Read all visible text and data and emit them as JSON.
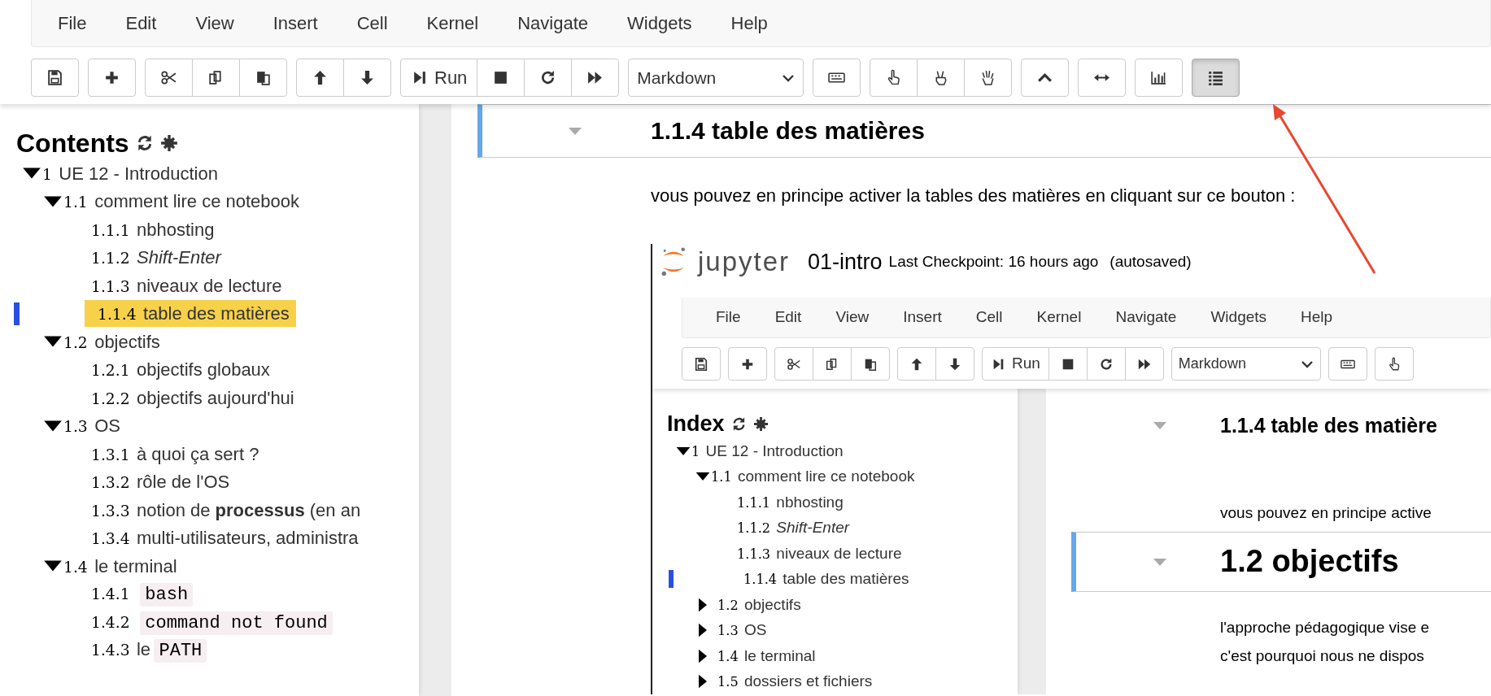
{
  "menu": [
    "File",
    "Edit",
    "View",
    "Insert",
    "Cell",
    "Kernel",
    "Navigate",
    "Widgets",
    "Help"
  ],
  "toolbar": [
    {
      "kind": "buttons",
      "buttons": [
        {
          "kind": "save",
          "pressed": false
        }
      ]
    },
    {
      "kind": "buttons",
      "buttons": [
        {
          "kind": "add",
          "pressed": false
        }
      ]
    },
    {
      "kind": "buttons",
      "buttons": [
        {
          "kind": "cut",
          "pressed": false
        },
        {
          "kind": "copy",
          "pressed": false
        },
        {
          "kind": "paste",
          "pressed": false
        }
      ]
    },
    {
      "kind": "buttons",
      "buttons": [
        {
          "kind": "move-up",
          "pressed": false
        },
        {
          "kind": "move-down",
          "pressed": false
        }
      ]
    },
    {
      "kind": "buttons",
      "buttons": [
        {
          "kind": "run",
          "label": "Run",
          "pressed": false
        },
        {
          "kind": "stop",
          "pressed": false
        },
        {
          "kind": "restart",
          "pressed": false
        },
        {
          "kind": "fast-forward",
          "pressed": false
        }
      ]
    },
    {
      "kind": "select",
      "value": "Markdown"
    },
    {
      "kind": "buttons",
      "buttons": [
        {
          "kind": "keyboard",
          "pressed": false
        }
      ]
    },
    {
      "kind": "buttons",
      "buttons": [
        {
          "kind": "pointing-hand",
          "pressed": false
        },
        {
          "kind": "peace-hand",
          "pressed": false
        },
        {
          "kind": "open-hand",
          "pressed": false
        }
      ]
    },
    {
      "kind": "buttons",
      "buttons": [
        {
          "kind": "chevron-up",
          "pressed": false
        }
      ]
    },
    {
      "kind": "buttons",
      "buttons": [
        {
          "kind": "arrows",
          "pressed": false
        }
      ]
    },
    {
      "kind": "buttons",
      "buttons": [
        {
          "kind": "bar-chart",
          "pressed": false
        }
      ]
    },
    {
      "kind": "buttons",
      "buttons": [
        {
          "kind": "list",
          "pressed": true
        }
      ]
    }
  ],
  "sidebar": {
    "title": "Contents",
    "highlight_selected": true,
    "items": [
      {
        "number": "1",
        "text": "UE 12 - Introduction",
        "expanded": true,
        "selected": false,
        "children": [
          {
            "number": "1.1",
            "text": "comment lire ce notebook",
            "expanded": true,
            "selected": false,
            "children": [
              {
                "number": "1.1.1",
                "text": "nbhosting",
                "selected": false
              },
              {
                "number": "1.1.2",
                "text": "Shift-Enter",
                "italic": true,
                "selected": false
              },
              {
                "number": "1.1.3",
                "text": "niveaux de lecture",
                "selected": false
              },
              {
                "number": "1.1.4",
                "text": "table des matières",
                "selected": true
              }
            ]
          },
          {
            "number": "1.2",
            "text": "objectifs",
            "expanded": true,
            "selected": false,
            "children": [
              {
                "number": "1.2.1",
                "text": "objectifs globaux",
                "selected": false
              },
              {
                "number": "1.2.2",
                "text": "objectifs aujourd'hui",
                "selected": false
              }
            ]
          },
          {
            "number": "1.3",
            "text": "OS",
            "expanded": true,
            "selected": false,
            "children": [
              {
                "number": "1.3.1",
                "text": "à quoi ça sert ?",
                "selected": false
              },
              {
                "number": "1.3.2",
                "text": "rôle de l'OS",
                "selected": false
              },
              {
                "number": "1.3.3",
                "text": "notion de **processus** (en an",
                "selected": false
              },
              {
                "number": "1.3.4",
                "text": "multi-utilisateurs, administra",
                "selected": false
              }
            ]
          },
          {
            "number": "1.4",
            "text": "le terminal",
            "expanded": true,
            "selected": false,
            "children": [
              {
                "number": "1.4.1",
                "code": "bash",
                "selected": false
              },
              {
                "number": "1.4.2",
                "code": "command not found",
                "selected": false
              },
              {
                "number": "1.4.3",
                "text": "le",
                "code": "PATH",
                "selected": false
              }
            ]
          }
        ]
      }
    ]
  },
  "notebook": {
    "cells": [
      {
        "kind": "h3",
        "text": "1.1.4  table des matières",
        "selected": true
      },
      {
        "kind": "text",
        "text": "vous pouvez en principe activer la tables des matières en cliquant sur ce bouton :"
      },
      {
        "kind": "screenshot",
        "logo_text": "jupyter",
        "notebook_name": "01-intro",
        "checkpoint": "Last Checkpoint: 16 hours ago",
        "autosave": "(autosaved)",
        "menu": [
          "File",
          "Edit",
          "View",
          "Insert",
          "Cell",
          "Kernel",
          "Navigate",
          "Widgets",
          "Help"
        ],
        "toolbar": [
          {
            "kind": "buttons",
            "buttons": [
              {
                "kind": "save",
                "pressed": false
              }
            ]
          },
          {
            "kind": "buttons",
            "buttons": [
              {
                "kind": "add",
                "pressed": false
              }
            ]
          },
          {
            "kind": "buttons",
            "buttons": [
              {
                "kind": "cut",
                "pressed": false
              },
              {
                "kind": "copy",
                "pressed": false
              },
              {
                "kind": "paste",
                "pressed": false
              }
            ]
          },
          {
            "kind": "buttons",
            "buttons": [
              {
                "kind": "move-up",
                "pressed": false
              },
              {
                "kind": "move-down",
                "pressed": false
              }
            ]
          },
          {
            "kind": "buttons",
            "buttons": [
              {
                "kind": "run",
                "label": "Run",
                "pressed": false
              },
              {
                "kind": "stop",
                "pressed": false
              },
              {
                "kind": "restart",
                "pressed": false
              },
              {
                "kind": "fast-forward",
                "pressed": false
              }
            ]
          },
          {
            "kind": "select",
            "value": "Markdown"
          },
          {
            "kind": "buttons",
            "buttons": [
              {
                "kind": "keyboard",
                "pressed": false
              }
            ]
          },
          {
            "kind": "buttons",
            "buttons": [
              {
                "kind": "pointing-hand",
                "pressed": false
              }
            ]
          }
        ],
        "sidebar": {
          "title": "Index",
          "highlight_selected": false,
          "items": [
            {
              "number": "1",
              "text": "UE 12 - Introduction",
              "expanded": true,
              "selected": false,
              "children": [
                {
                  "number": "1.1",
                  "text": "comment lire ce notebook",
                  "expanded": true,
                  "selected": false,
                  "children": [
                    {
                      "number": "1.1.1",
                      "text": "nbhosting",
                      "selected": false
                    },
                    {
                      "number": "1.1.2",
                      "text": "Shift-Enter",
                      "italic": true,
                      "selected": false
                    },
                    {
                      "number": "1.1.3",
                      "text": "niveaux de lecture",
                      "selected": false
                    },
                    {
                      "number": "1.1.4",
                      "text": "table des matières",
                      "selected": true
                    }
                  ]
                },
                {
                  "number": "1.2",
                  "text": "objectifs",
                  "expanded": false,
                  "selected": false
                },
                {
                  "number": "1.3",
                  "text": "OS",
                  "expanded": false,
                  "selected": false
                },
                {
                  "number": "1.4",
                  "text": "le terminal",
                  "expanded": false,
                  "selected": false
                },
                {
                  "number": "1.5",
                  "text": "dossiers et fichiers",
                  "expanded": false,
                  "selected": false
                }
              ]
            }
          ]
        },
        "cells": [
          {
            "kind": "h3",
            "text": "1.1.4  table des matière",
            "selected": false
          },
          {
            "kind": "text",
            "text": "vous pouvez en principe active"
          },
          {
            "kind": "h2",
            "text": "1.2  objectifs",
            "selected": true
          },
          {
            "kind": "text",
            "text": "l'approche pédagogique vise e"
          },
          {
            "kind": "text",
            "text": "c'est pourquoi nous ne dispos"
          }
        ]
      }
    ]
  }
}
